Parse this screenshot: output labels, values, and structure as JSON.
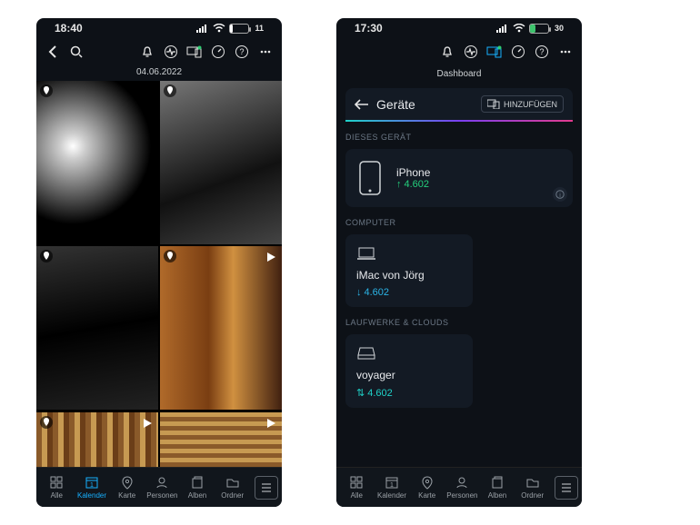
{
  "left": {
    "status": {
      "time": "18:40",
      "battery_pct": 11
    },
    "date": "04.06.2022",
    "thumbs": [
      {
        "has_location": true,
        "is_video": false,
        "cls": "bw1"
      },
      {
        "has_location": true,
        "is_video": false,
        "cls": "bw2"
      },
      {
        "has_location": true,
        "is_video": false,
        "cls": "bw3"
      },
      {
        "has_location": true,
        "is_video": true,
        "cls": "col1"
      },
      {
        "has_location": true,
        "is_video": true,
        "cls": "mos1"
      },
      {
        "has_location": false,
        "is_video": true,
        "cls": "mos2"
      }
    ],
    "tabs": [
      {
        "id": "alle",
        "label": "Alle",
        "active": false
      },
      {
        "id": "kalender",
        "label": "Kalender",
        "active": true
      },
      {
        "id": "karte",
        "label": "Karte",
        "active": false
      },
      {
        "id": "personen",
        "label": "Personen",
        "active": false
      },
      {
        "id": "alben",
        "label": "Alben",
        "active": false
      },
      {
        "id": "ordner",
        "label": "Ordner",
        "active": false
      }
    ]
  },
  "right": {
    "status": {
      "time": "17:30",
      "battery_pct": 30
    },
    "subtitle": "Dashboard",
    "header": {
      "title": "Geräte",
      "add_label": "HINZUFÜGEN"
    },
    "sections": {
      "this_device": {
        "label": "DIESES GERÄT",
        "name": "iPhone",
        "count": "4.602",
        "dir": "up"
      },
      "computer": {
        "label": "COMPUTER",
        "name": "iMac von Jörg",
        "count": "4.602",
        "dir": "down"
      },
      "drives": {
        "label": "LAUFWERKE & CLOUDS",
        "name": "voyager",
        "count": "4.602",
        "dir": "sync"
      }
    },
    "tabs": [
      {
        "id": "alle",
        "label": "Alle",
        "active": false
      },
      {
        "id": "kalender",
        "label": "Kalender",
        "active": false
      },
      {
        "id": "karte",
        "label": "Karte",
        "active": false
      },
      {
        "id": "personen",
        "label": "Personen",
        "active": false
      },
      {
        "id": "alben",
        "label": "Alben",
        "active": false
      },
      {
        "id": "ordner",
        "label": "Ordner",
        "active": false
      }
    ]
  }
}
